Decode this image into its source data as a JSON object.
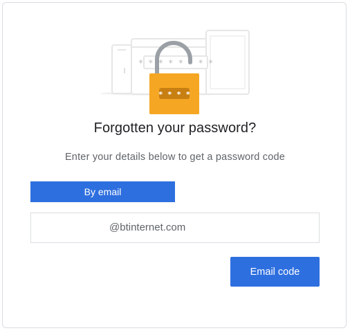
{
  "page": {
    "title": "Forgotten your password?",
    "subtitle": "Enter your details below to get a password code"
  },
  "illustration": {
    "password_mask": "* * * * * * * *",
    "lock_code": "* * * *",
    "lock_color": "#f5a623",
    "icon": "padlock-devices-icon"
  },
  "tabs": {
    "active_label": "By email"
  },
  "email_field": {
    "value": "",
    "domain_suffix": "@btinternet.com"
  },
  "actions": {
    "submit_label": "Email code"
  },
  "colors": {
    "accent": "#2e6fdf",
    "border": "#dadce0",
    "text_primary": "#202124",
    "text_secondary": "#5f6368"
  }
}
